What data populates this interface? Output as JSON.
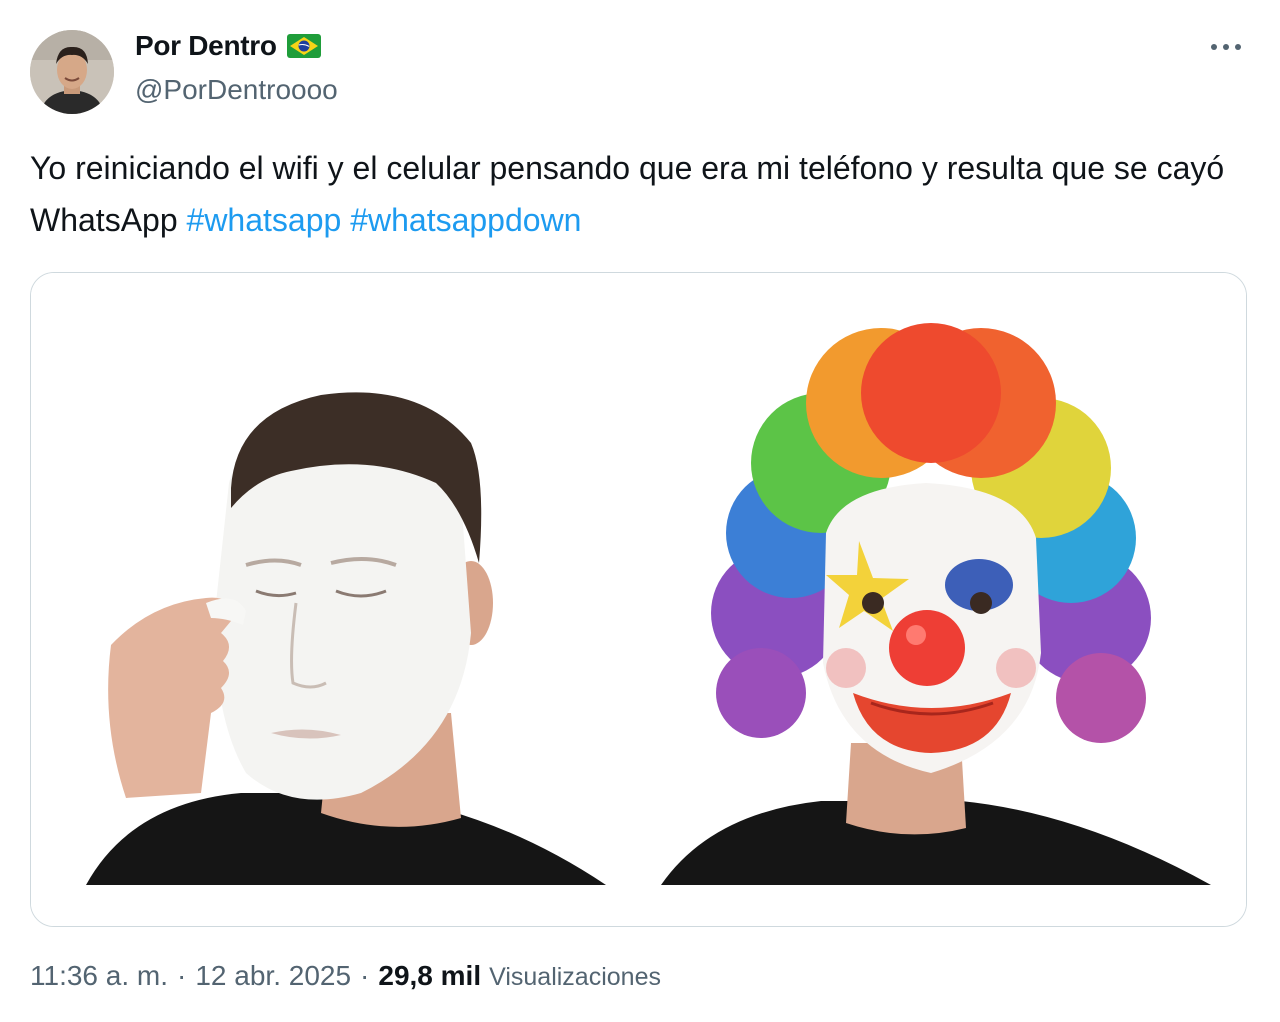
{
  "author": {
    "display_name": "Por Dentro",
    "handle": "@PorDentroooo",
    "flag_icon": "brazil-flag-icon",
    "avatar_icon": "profile-photo"
  },
  "header": {
    "more_icon": "more-options-icon"
  },
  "tweet": {
    "text": "Yo reiniciando el wifi y el celular pensando que era mi teléfono y resulta que se cayó WhatsApp",
    "hashtags": [
      "#whatsapp",
      "#whatsappdown"
    ]
  },
  "media": {
    "panels": [
      "mime-face-paint-photo",
      "clown-makeup-rainbow-wig-photo"
    ]
  },
  "meta": {
    "time": "11:36 a. m.",
    "separator": "·",
    "date": "12 abr. 2025",
    "views_count": "29,8 mil",
    "views_label": "Visualizaciones"
  },
  "colors": {
    "text": "#0f1419",
    "secondary": "#536471",
    "link": "#1d9bf0",
    "border": "#cfd9de"
  }
}
